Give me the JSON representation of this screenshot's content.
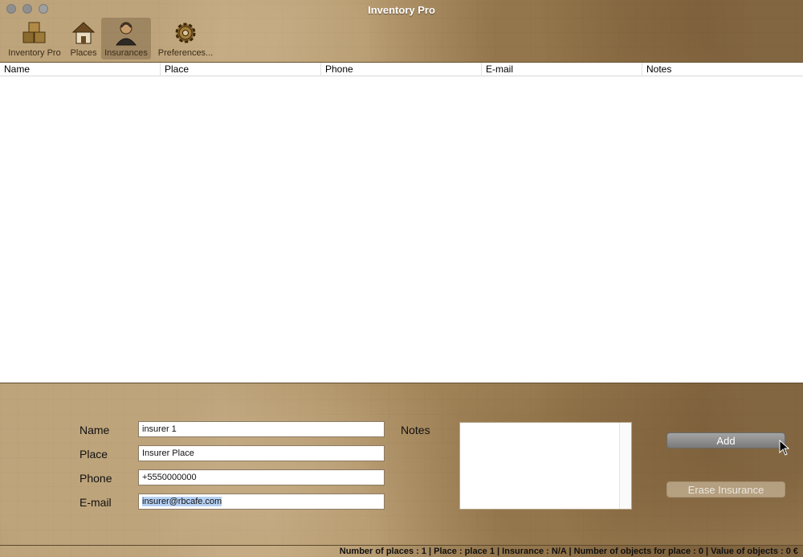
{
  "window": {
    "title": "Inventory Pro"
  },
  "toolbar": {
    "items": [
      {
        "label": "Inventory Pro",
        "icon": "boxes-icon"
      },
      {
        "label": "Places",
        "icon": "house-icon"
      },
      {
        "label": "Insurances",
        "icon": "agent-icon",
        "selected": true
      },
      {
        "label": "Preferences...",
        "icon": "gear-icon"
      }
    ]
  },
  "table": {
    "columns": [
      "Name",
      "Place",
      "Phone",
      "E-mail",
      "Notes"
    ],
    "rows": []
  },
  "form": {
    "name_label": "Name",
    "name_value": "insurer 1",
    "place_label": "Place",
    "place_value": "Insurer Place",
    "phone_label": "Phone",
    "phone_value": "+5550000000",
    "email_label": "E-mail",
    "email_value": "insurer@rbcafe.com",
    "notes_label": "Notes",
    "notes_value": "",
    "add_label": "Add",
    "erase_label": "Erase Insurance"
  },
  "status": {
    "text": "Number of places : 1 | Place : place 1 | Insurance : N/A | Number of objects for place : 0 | Value of objects : 0 €"
  },
  "colors": {
    "paper": "#a88a5e",
    "selection": "#b5d0f2"
  }
}
